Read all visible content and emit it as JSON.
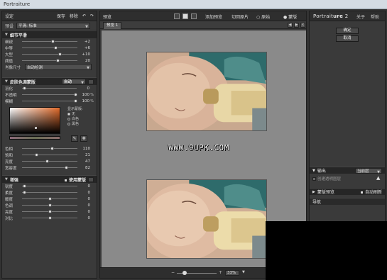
{
  "window": {
    "title": "Portraiture"
  },
  "left": {
    "topbar": {
      "settings": "设定",
      "save": "保存",
      "remove": "移除",
      "undo": "↶",
      "redo": "↷"
    },
    "preset": {
      "label": "预设",
      "value": "平滑: 标准"
    },
    "detail": {
      "title": "细节平滑",
      "sliders": [
        {
          "label": "细锐",
          "value": "+2",
          "pos": 0.56
        },
        {
          "label": "中等",
          "value": "+6",
          "pos": 0.62
        },
        {
          "label": "大型",
          "value": "+10",
          "pos": 0.7
        },
        {
          "label": "阈值",
          "value": "20",
          "pos": 0.66
        }
      ],
      "size_label": "肖像尺寸",
      "size_value": "自动检测"
    },
    "skin": {
      "title": "皮肤色调蒙版",
      "mode": "自动",
      "sliders": [
        {
          "label": "羽化",
          "value": "0",
          "unit": "",
          "pos": 0.02
        },
        {
          "label": "不透明",
          "value": "100",
          "unit": "%",
          "pos": 1.0
        },
        {
          "label": "模糊",
          "value": "100",
          "unit": "%",
          "pos": 1.0
        }
      ],
      "display_mask": {
        "title": "显示蒙版:",
        "options": [
          "无",
          "白色",
          "黑色"
        ],
        "selected": 0
      },
      "hsl": [
        {
          "label": "色相",
          "value": "110",
          "pos": 0.55
        },
        {
          "label": "饱和",
          "value": "21",
          "pos": 0.25
        },
        {
          "label": "亮度",
          "value": "47",
          "pos": 0.45
        },
        {
          "label": "宽容度",
          "value": "82",
          "pos": 0.82
        }
      ]
    },
    "enhance": {
      "title": "增强",
      "use_mask": "使用蒙版",
      "sliders": [
        {
          "label": "锐度",
          "value": "0",
          "pos": 0.02
        },
        {
          "label": "柔度",
          "value": "0",
          "pos": 0.02
        },
        {
          "label": "暖度",
          "value": "0",
          "pos": 0.5
        },
        {
          "label": "色调",
          "value": "0",
          "pos": 0.5
        },
        {
          "label": "亮度",
          "value": "0",
          "pos": 0.5
        },
        {
          "label": "对比",
          "value": "0",
          "pos": 0.5
        }
      ]
    }
  },
  "center": {
    "preview_label": "预览",
    "add_preview": "添加预览",
    "compare": "切回原片",
    "original": "原始",
    "mask": "蒙版",
    "tab": "预览 1",
    "watermark": "WWW.9UPK.COM",
    "zoom": "33%"
  },
  "right": {
    "logo_a": "Portrait",
    "logo_b": "ure",
    "logo_c": " 2",
    "about": "关于",
    "help": "帮助",
    "ok": "确定",
    "cancel": "取消",
    "output_title": "输出",
    "output_value": "当前层",
    "output_check": "创建透明图层",
    "mask_preview": "蒙版预览",
    "auto_refresh": "自动刷新",
    "navigator": "导航"
  }
}
